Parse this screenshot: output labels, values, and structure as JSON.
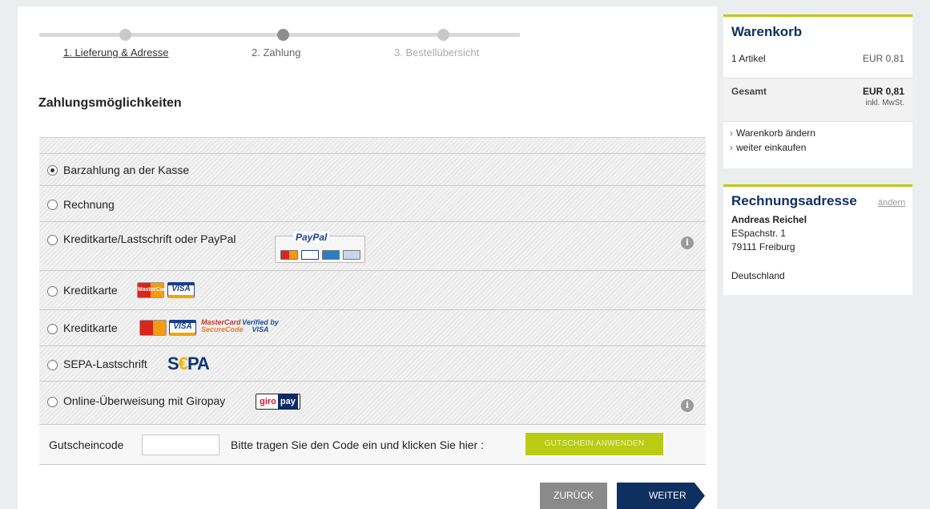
{
  "steps": {
    "step1": "1. Lieferung & Adresse",
    "step2": "2. Zahlung",
    "step3": "3. Bestellübersicht"
  },
  "section_title": "Zahlungsmöglichkeiten",
  "payment_options": [
    {
      "label": "Barzahlung an der Kasse",
      "selected": true
    },
    {
      "label": "Rechnung",
      "selected": false
    },
    {
      "label": "Kreditkarte/Lastschrift oder PayPal",
      "selected": false
    },
    {
      "label": "Kreditkarte",
      "selected": false
    },
    {
      "label": "Kreditkarte",
      "selected": false
    },
    {
      "label": "SEPA-Lastschrift",
      "selected": false
    },
    {
      "label": "Online-Überweisung mit Giropay",
      "selected": false
    }
  ],
  "logos": {
    "paypal": "PayPal",
    "mastercard": "MasterCard",
    "visa": "VISA",
    "amex": "AMEX",
    "mc_securecode_1": "MasterCard",
    "mc_securecode_2": "SecureCode",
    "verified_1": "Verified by",
    "verified_2": "VISA",
    "sepa_s": "S",
    "sepa_e": "€",
    "sepa_pa": "PA",
    "giro_g": "giro",
    "giro_p": "pay"
  },
  "info_icon": "i",
  "coupon": {
    "label": "Gutscheincode",
    "value": "",
    "hint": "Bitte tragen Sie den Code ein und klicken Sie hier :",
    "button": "GUTSCHEIN ANWENDEN"
  },
  "nav": {
    "back": "ZURÜCK",
    "next": "WEITER"
  },
  "cart": {
    "title": "Warenkorb",
    "items_label": "1 Artikel",
    "items_price": "EUR 0,81",
    "total_label": "Gesamt",
    "total_price": "EUR 0,81",
    "vat_note": "inkl. MwSt.",
    "link_edit": "Warenkorb ändern",
    "link_continue": "weiter einkaufen"
  },
  "billing": {
    "title": "Rechnungsadresse",
    "edit": "ändern",
    "name": "Andreas Reichel",
    "street": "ESpachstr. 1",
    "city": "79111 Freiburg",
    "country": "Deutschland"
  },
  "colors": {
    "accent_green": "#b9cb13",
    "navy": "#0e3060",
    "arrow_red": "#e0342f"
  }
}
